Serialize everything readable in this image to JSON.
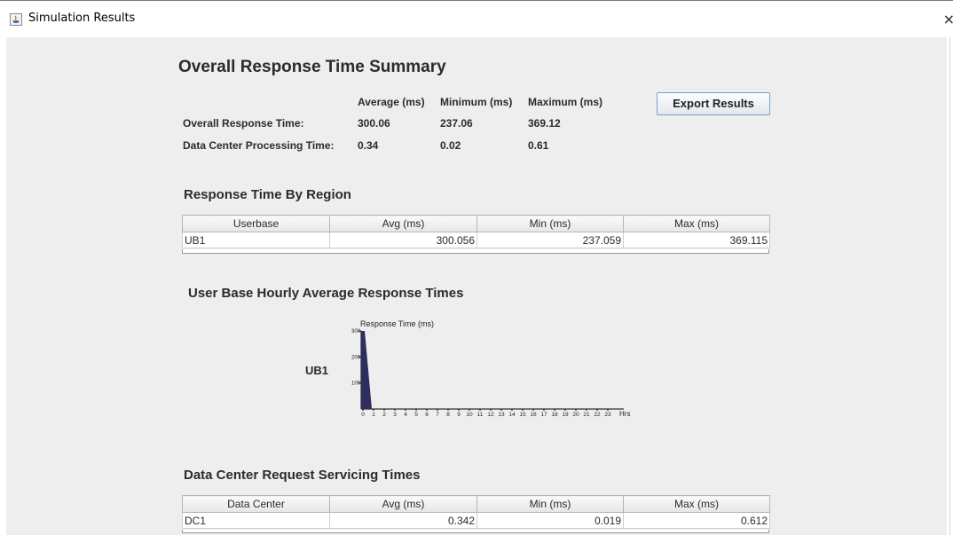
{
  "window": {
    "title": "Simulation Results",
    "close_glyph": "×"
  },
  "summary": {
    "title": "Overall Response Time Summary",
    "columns": [
      "Average (ms)",
      "Minimum (ms)",
      "Maximum (ms)"
    ],
    "rows": [
      {
        "label": "Overall Response Time:",
        "values": [
          "300.06",
          "237.06",
          "369.12"
        ]
      },
      {
        "label": "Data Center Processing Time:",
        "values": [
          "0.34",
          "0.02",
          "0.61"
        ]
      }
    ]
  },
  "toolbar": {
    "export_label": "Export Results"
  },
  "region": {
    "title": "Response Time By Region",
    "headers": [
      "Userbase",
      "Avg (ms)",
      "Min (ms)",
      "Max (ms)"
    ],
    "rows": [
      [
        "UB1",
        "300.056",
        "237.059",
        "369.115"
      ]
    ]
  },
  "hourly": {
    "title": "User Base Hourly Average Response Times",
    "userbase_label": "UB1"
  },
  "chart_data": {
    "type": "bar",
    "title": "",
    "xlabel": "Hrs",
    "ylabel": "Response Time (ms)",
    "ylim": [
      0,
      300
    ],
    "yticks": [
      "100",
      "200",
      "300"
    ],
    "categories": [
      "0",
      "1",
      "2",
      "3",
      "4",
      "5",
      "6",
      "7",
      "8",
      "9",
      "10",
      "11",
      "12",
      "13",
      "14",
      "15",
      "16",
      "17",
      "18",
      "19",
      "20",
      "21",
      "22",
      "23"
    ],
    "values": [
      300,
      0,
      0,
      0,
      0,
      0,
      0,
      0,
      0,
      0,
      0,
      0,
      0,
      0,
      0,
      0,
      0,
      0,
      0,
      0,
      0,
      0,
      0,
      0
    ],
    "bar_color": "#2e2e5e"
  },
  "datacenter": {
    "title": "Data Center Request Servicing Times",
    "headers": [
      "Data Center",
      "Avg (ms)",
      "Min (ms)",
      "Max (ms)"
    ],
    "rows": [
      [
        "DC1",
        "0.342",
        "0.019",
        "0.612"
      ]
    ]
  }
}
